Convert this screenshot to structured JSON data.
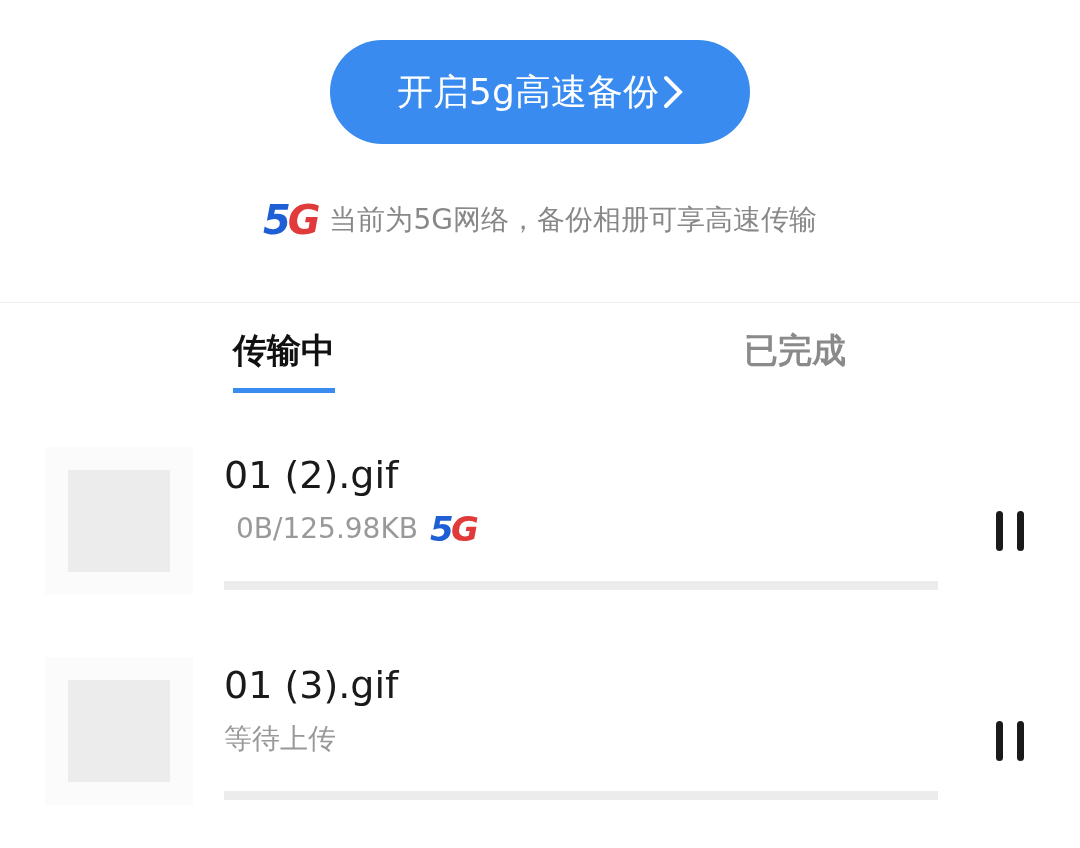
{
  "backup_button": {
    "label": "开启5g高速备份"
  },
  "network_hint": {
    "logo": "5G",
    "text": "当前为5G网络，备份相册可享高速传输"
  },
  "tabs": [
    {
      "label": "传输中",
      "selected": true
    },
    {
      "label": "已完成",
      "selected": false
    }
  ],
  "transfers": [
    {
      "name": "01 (2).gif",
      "status": "0B/125.98KB",
      "logo": "5G",
      "level": 0,
      "paused": false
    },
    {
      "name": "01 (3).gif",
      "status": "等待上传",
      "level": 0,
      "paused": false
    }
  ]
}
